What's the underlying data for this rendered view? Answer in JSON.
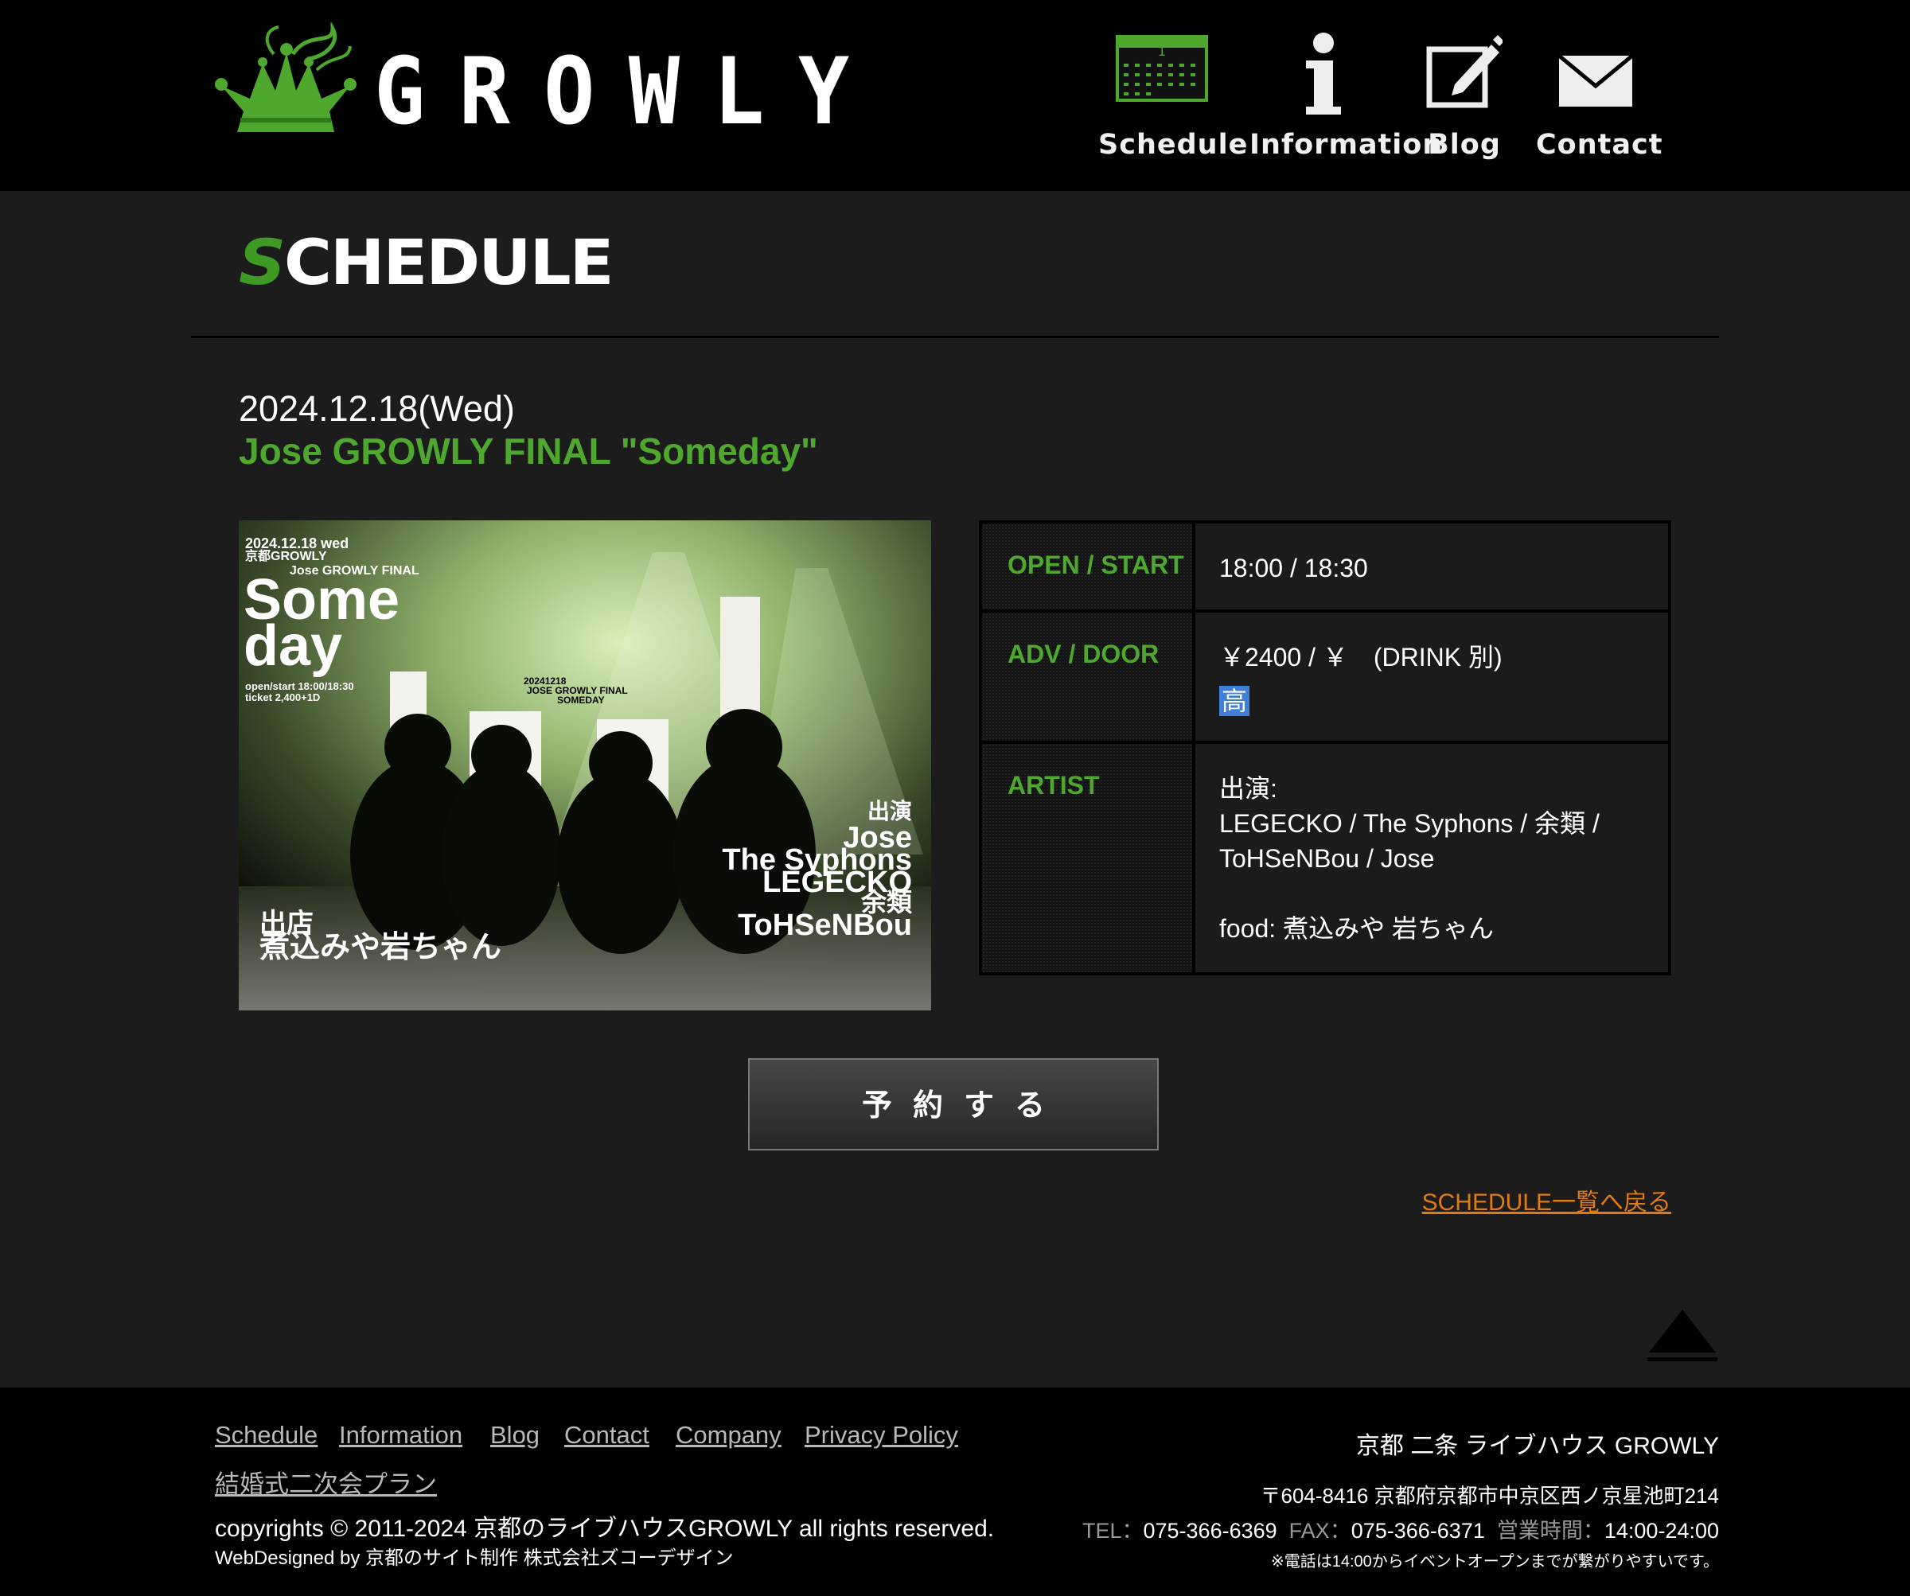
{
  "brand": {
    "name": "GROWLY"
  },
  "nav": {
    "schedule": "Schedule",
    "information": "Information",
    "blog": "Blog",
    "contact": "Contact"
  },
  "page": {
    "heading_first": "S",
    "heading_rest": "CHEDULE"
  },
  "event": {
    "date": "2024.12.18(Wed)",
    "title": "Jose GROWLY FINAL \"Someday\""
  },
  "flyer": {
    "date_line": "2024.12.18 wed",
    "venue_line": "京都GROWLY",
    "event_line": "Jose GROWLY FINAL",
    "title_1": "Some",
    "title_2": "day",
    "open_line": "open/start 18:00/18:30",
    "ticket_line": "ticket 2,400+1D",
    "center_date": "20241218",
    "center_1": "JOSE GROWLY FINAL",
    "center_2": "SOMEDAY",
    "cast_label": "出演",
    "cast": [
      "Jose",
      "The Syphons",
      "LEGECKO",
      "余類",
      "ToHSeNBou"
    ],
    "shop_label": "出店",
    "shop_name": "煮込みや岩ちゃん"
  },
  "details": {
    "open_label": "OPEN / START",
    "open_value": "18:00 / 18:30",
    "adv_label": "ADV / DOOR",
    "adv_value": "￥2400 / ￥　(DRINK 別)",
    "adv_badge": "高",
    "artist_label": "ARTIST",
    "artist_line1": "出演:",
    "artist_line2": "LEGECKO / The Syphons / 余類 /",
    "artist_line3": "ToHSeNBou / Jose",
    "artist_food": "food: 煮込みや 岩ちゃん"
  },
  "actions": {
    "reserve": "予約する",
    "back": "SCHEDULE一覧へ戻る"
  },
  "footer": {
    "links": [
      "Schedule",
      "Information",
      "Blog",
      "Contact",
      "Company",
      "Privacy Policy"
    ],
    "wedding": "結婚式二次会プラン",
    "copyright": "copyrights © 2011-2024 京都のライブハウスGROWLY all rights reserved.",
    "webdesign": "WebDesigned by 京都のサイト制作 株式会社ズコーデザイン",
    "venue": "京都 二条 ライブハウス GROWLY",
    "address": "〒604-8416 京都府京都市中京区西ノ京星池町214",
    "tel_label": "TEL：",
    "tel": "075-366-6369",
    "fax_label": "FAX：",
    "fax": "075-366-6371",
    "hours_label": "営業時間：",
    "hours": "14:00-24:00",
    "note": "※電話は14:00からイベントオープンまでが繋がりやすいです。"
  },
  "colors": {
    "accent_green": "#4ea82e",
    "link_orange": "#e07a13",
    "badge_blue": "#3f7fd6"
  }
}
